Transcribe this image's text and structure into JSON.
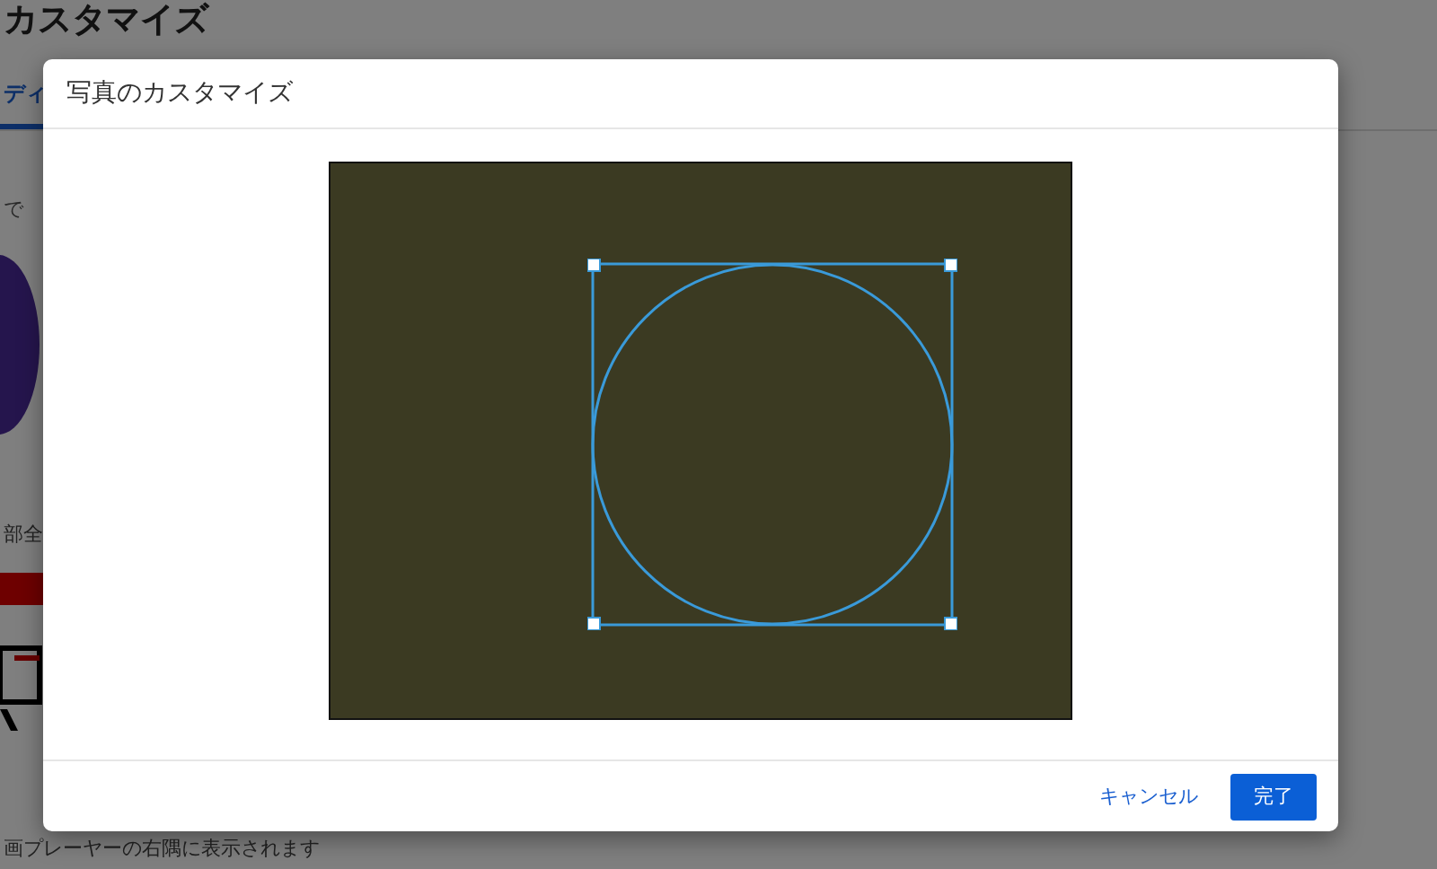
{
  "background_page": {
    "title": "カスタマイズ",
    "tab": {
      "label": "ディ",
      "selected": true
    },
    "text_1": "で",
    "text_2": "部全",
    "caption": "画プレーヤーの右隅に表示されます"
  },
  "dialog": {
    "title": "写真のカスタマイズ",
    "buttons": [
      {
        "label": "キャンセル",
        "kind": "text"
      },
      {
        "label": "完了",
        "kind": "primary"
      }
    ]
  }
}
